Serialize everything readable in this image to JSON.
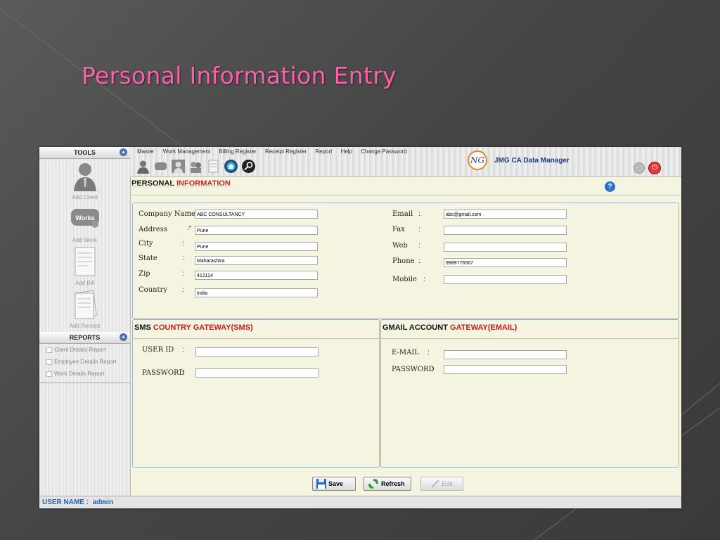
{
  "slide": {
    "title": "Personal Information Entry"
  },
  "app": {
    "brand": {
      "logo_text": "NG",
      "name": "JMG CA Data Manager"
    },
    "menu": [
      "Master",
      "Work Management",
      "Billing Register",
      "Receipt Register",
      "Report",
      "Help",
      "Change Password"
    ],
    "tools_header": "TOOLS",
    "tools": [
      {
        "label": "Add Client",
        "icon": "client-icon"
      },
      {
        "label": "Add Work",
        "icon": "works-icon",
        "badge": "Works"
      },
      {
        "label": "Add Bill",
        "icon": "bill-icon"
      },
      {
        "label": "Add Receipt",
        "icon": "receipt-icon"
      }
    ],
    "reports_header": "REPORTS",
    "reports": [
      "Client Details Report",
      "Employee Details Report",
      "Work Details Report"
    ],
    "status": {
      "label": "USER NAME :",
      "value": "admin"
    },
    "section_header": {
      "bold": "PERSONAL",
      "red": "INFORMATION"
    },
    "personal": {
      "left": [
        {
          "label": "Company Name",
          "required": true,
          "value": "ABC CONSULTANCY"
        },
        {
          "label": "Address",
          "required": true,
          "value": "Pune"
        },
        {
          "label": "City",
          "required": false,
          "value": "Pune"
        },
        {
          "label": "State",
          "required": false,
          "value": "Maharashtra"
        },
        {
          "label": "Zip",
          "required": false,
          "value": "412114"
        },
        {
          "label": "Country",
          "required": false,
          "value": "India"
        }
      ],
      "right": [
        {
          "label": "Email",
          "value": "abc@gmail.com"
        },
        {
          "label": "Fax",
          "value": ""
        },
        {
          "label": "Web",
          "value": ""
        },
        {
          "label": "Phone",
          "value": "9989776567"
        },
        {
          "label": "Mobile",
          "value": ""
        }
      ]
    },
    "sms": {
      "header": {
        "bold": "SMS",
        "red": "COUNTRY GATEWAY(SMS)"
      },
      "fields": [
        {
          "label": "USER ID",
          "value": ""
        },
        {
          "label": "PASSWORD",
          "value": ""
        }
      ]
    },
    "gmail": {
      "header": {
        "bold": "GMAIL ACCOUNT",
        "red": "GATEWAY(EMAIL)"
      },
      "fields": [
        {
          "label": "E-MAIL",
          "value": ""
        },
        {
          "label": "PASSWORD",
          "value": ""
        }
      ]
    },
    "buttons": {
      "save": "Save",
      "refresh": "Refresh",
      "edit": "Edit"
    },
    "colors": {
      "accent_red": "#c02020",
      "title_pink": "#ff5fa8",
      "status_blue": "#2a5fa8"
    }
  }
}
